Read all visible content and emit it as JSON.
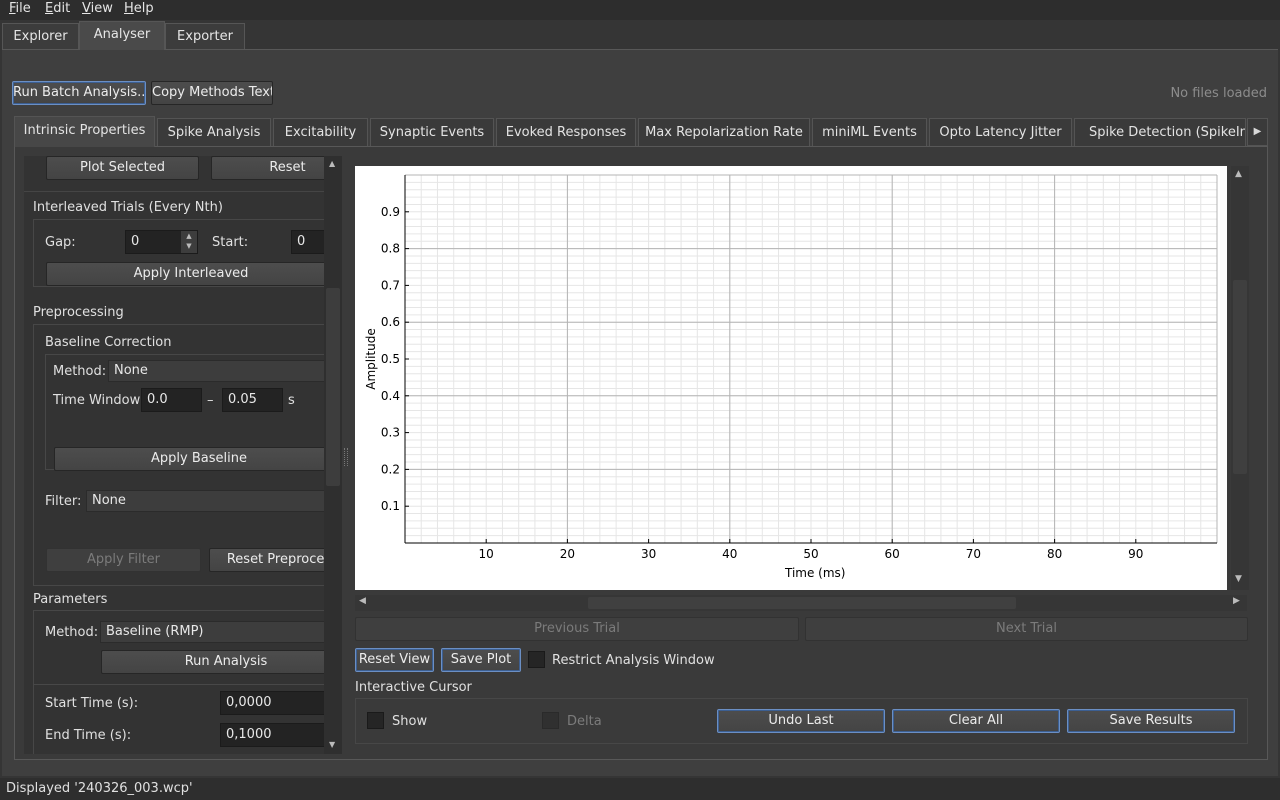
{
  "menu": {
    "file": "File",
    "edit": "Edit",
    "view": "View",
    "help": "Help"
  },
  "main_tabs": [
    "Explorer",
    "Analyser",
    "Exporter"
  ],
  "toolbar": {
    "batch": "Run Batch Analysis...",
    "copy": "Copy Methods Text",
    "status": "No files loaded"
  },
  "sub_tabs": [
    "Intrinsic Properties",
    "Spike Analysis",
    "Excitability",
    "Synaptic Events",
    "Evoked Responses",
    "Max Repolarization Rate",
    "miniML Events",
    "Opto Latency Jitter",
    "Spike Detection (SpikeInt"
  ],
  "left": {
    "plot_selected": "Plot Selected",
    "reset": "Reset",
    "interleaved_title": "Interleaved Trials (Every Nth)",
    "gap_label": "Gap:",
    "gap_value": "0",
    "start_label": "Start:",
    "start_value": "0",
    "apply_interleaved": "Apply Interleaved",
    "preprocessing": "Preprocessing",
    "baseline_title": "Baseline Correction",
    "method_label": "Method:",
    "method_value": "None",
    "time_window_label": "Time Window:",
    "tw_start": "0.0",
    "tw_dash": "–",
    "tw_end": "0.05",
    "tw_unit": "s",
    "apply_baseline": "Apply Baseline",
    "filter_label": "Filter:",
    "filter_value": "None",
    "apply_filter": "Apply Filter",
    "reset_preproc": "Reset Preproces",
    "parameters": "Parameters",
    "param_method_label": "Method:",
    "param_method_value": "Baseline (RMP)",
    "run_analysis": "Run Analysis",
    "start_time_label": "Start Time (s):",
    "start_time_value": "0,0000",
    "end_time_label": "End Time (s):",
    "end_time_value": "0,1000"
  },
  "chart_data": {
    "type": "line",
    "xlabel": "Time (ms)",
    "ylabel": "Amplitude",
    "xlim": [
      0,
      100
    ],
    "ylim": [
      0,
      1
    ],
    "xticks": [
      10,
      20,
      30,
      40,
      50,
      60,
      70,
      80,
      90
    ],
    "yticks": [
      0.1,
      0.2,
      0.3,
      0.4,
      0.5,
      0.6,
      0.7,
      0.8,
      0.9
    ],
    "grid": true,
    "series": []
  },
  "nav": {
    "prev": "Previous Trial",
    "next": "Next Trial"
  },
  "plot_controls": {
    "reset_view": "Reset View",
    "save_plot": "Save Plot",
    "restrict": "Restrict Analysis Window"
  },
  "cursor": {
    "title": "Interactive Cursor",
    "show": "Show",
    "delta": "Delta",
    "undo": "Undo Last",
    "clear": "Clear All",
    "save": "Save Results"
  },
  "status": "Displayed '240326_003.wcp'"
}
